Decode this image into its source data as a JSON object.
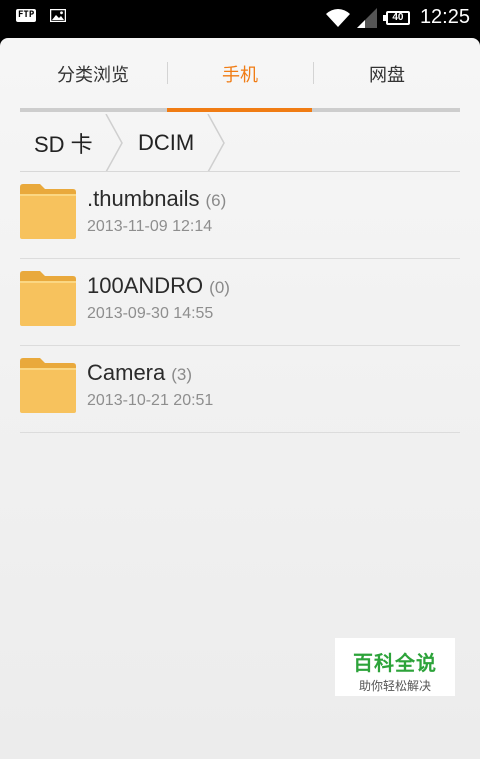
{
  "status_bar": {
    "ftp_label": "FTP",
    "battery": "40",
    "time": "12:25"
  },
  "tabs": [
    {
      "label": "分类浏览",
      "active": false
    },
    {
      "label": "手机",
      "active": true
    },
    {
      "label": "网盘",
      "active": false
    }
  ],
  "breadcrumb": [
    "SD 卡",
    "DCIM"
  ],
  "files": [
    {
      "name": ".thumbnails",
      "count": "(6)",
      "date": "2013-11-09 12:14"
    },
    {
      "name": "100ANDRO",
      "count": "(0)",
      "date": "2013-09-30 14:55"
    },
    {
      "name": "Camera",
      "count": "(3)",
      "date": "2013-10-21 20:51"
    }
  ],
  "watermark": {
    "title": "百科全说",
    "subtitle": "助你轻松解决"
  },
  "colors": {
    "accent": "#f07c14",
    "folder": "#f7c25d",
    "watermark_green": "#2da33a"
  }
}
